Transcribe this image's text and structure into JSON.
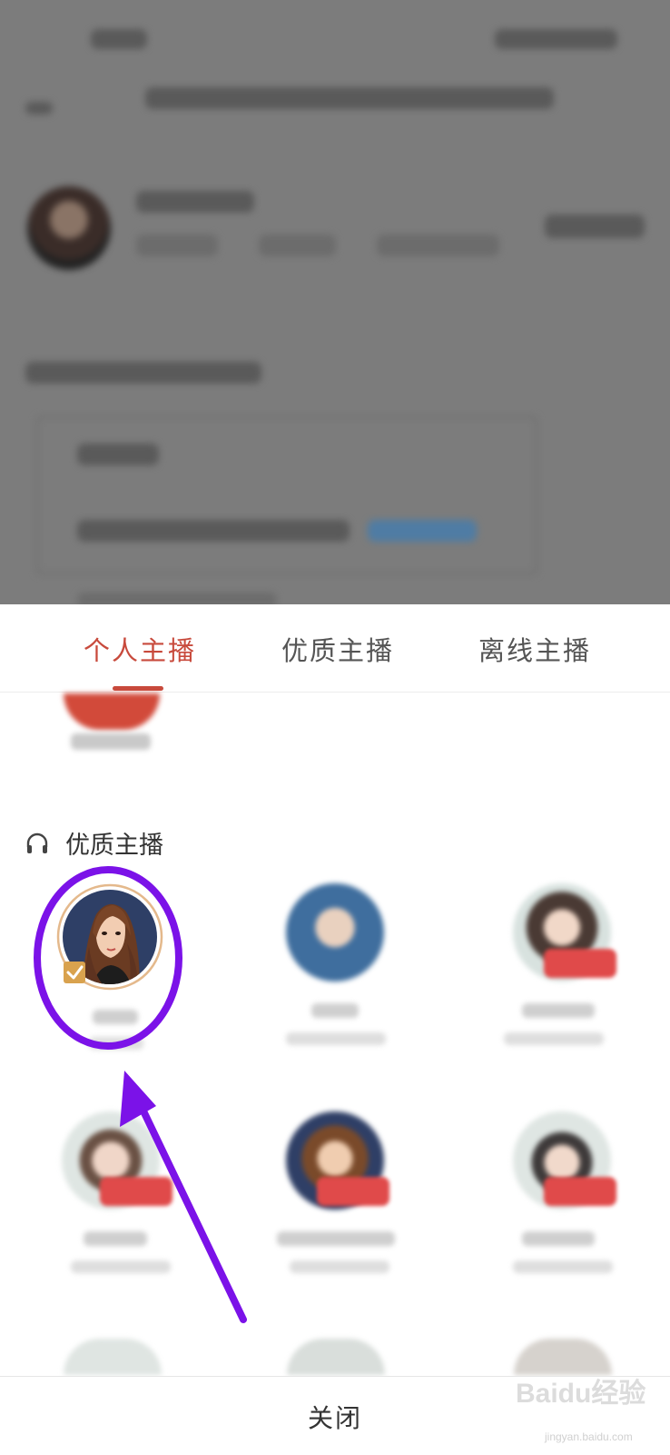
{
  "tabs": [
    {
      "label": "个人主播",
      "active": true
    },
    {
      "label": "优质主播",
      "active": false
    },
    {
      "label": "离线主播",
      "active": false
    }
  ],
  "section": {
    "title": "优质主播",
    "icon": "headphones-icon"
  },
  "selected_anchor": {
    "checked": true,
    "icon": "checkbox-checked-icon"
  },
  "footer": {
    "close_label": "关闭"
  },
  "watermark": {
    "brand": "Baidu经验",
    "url": "jingyan.baidu.com"
  },
  "colors": {
    "accent": "#c84a3c",
    "annotation": "#7b12e8",
    "checkbox": "#d9a24e"
  }
}
